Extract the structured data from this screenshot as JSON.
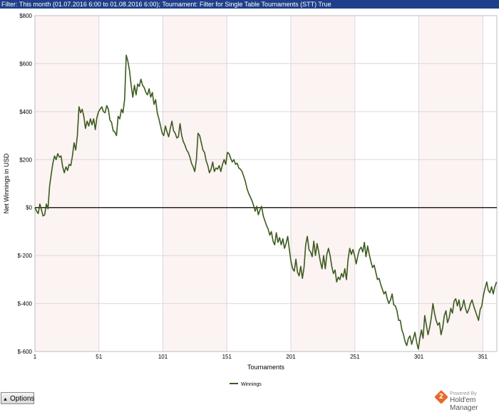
{
  "filter": {
    "text": "Filter: This month (01.07.2016 6:00 to 01.08.2016 6:00); Tournament: Filter for Single Table Tournaments (STT) True"
  },
  "chart_data": {
    "type": "line",
    "xlabel": "Tournaments",
    "ylabel": "Net Winnings in USD",
    "xlim": [
      1,
      362
    ],
    "ylim": [
      -600,
      800
    ],
    "x_ticks": [
      1,
      51,
      101,
      151,
      201,
      251,
      301,
      351
    ],
    "y_ticks": [
      -600,
      -400,
      -200,
      0,
      200,
      400,
      600,
      800
    ],
    "y_tick_labels": [
      "$-600",
      "$-400",
      "$-200",
      "$0",
      "$200",
      "$400",
      "$600",
      "$800"
    ],
    "grid": true,
    "legend_position": "bottom-center",
    "series": [
      {
        "name": "Winnings",
        "color": "#3c5a1e",
        "points": [
          [
            1,
            0
          ],
          [
            2,
            -15
          ],
          [
            3,
            -25
          ],
          [
            4,
            15
          ],
          [
            5,
            -10
          ],
          [
            6,
            -35
          ],
          [
            7,
            -30
          ],
          [
            8,
            15
          ],
          [
            9,
            -5
          ],
          [
            10,
            90
          ],
          [
            11,
            140
          ],
          [
            12,
            185
          ],
          [
            13,
            215
          ],
          [
            14,
            200
          ],
          [
            15,
            225
          ],
          [
            16,
            210
          ],
          [
            17,
            215
          ],
          [
            18,
            170
          ],
          [
            19,
            145
          ],
          [
            20,
            170
          ],
          [
            21,
            155
          ],
          [
            22,
            180
          ],
          [
            23,
            175
          ],
          [
            24,
            215
          ],
          [
            25,
            270
          ],
          [
            26,
            240
          ],
          [
            27,
            300
          ],
          [
            28,
            420
          ],
          [
            29,
            395
          ],
          [
            30,
            410
          ],
          [
            31,
            380
          ],
          [
            32,
            330
          ],
          [
            33,
            360
          ],
          [
            34,
            340
          ],
          [
            35,
            370
          ],
          [
            36,
            345
          ],
          [
            37,
            370
          ],
          [
            38,
            325
          ],
          [
            39,
            375
          ],
          [
            40,
            400
          ],
          [
            41,
            410
          ],
          [
            42,
            420
          ],
          [
            43,
            400
          ],
          [
            44,
            395
          ],
          [
            45,
            425
          ],
          [
            46,
            410
          ],
          [
            47,
            365
          ],
          [
            48,
            355
          ],
          [
            49,
            320
          ],
          [
            50,
            315
          ],
          [
            51,
            300
          ],
          [
            52,
            380
          ],
          [
            53,
            370
          ],
          [
            54,
            410
          ],
          [
            55,
            395
          ],
          [
            56,
            450
          ],
          [
            57,
            635
          ],
          [
            58,
            610
          ],
          [
            59,
            570
          ],
          [
            60,
            510
          ],
          [
            61,
            460
          ],
          [
            62,
            510
          ],
          [
            63,
            470
          ],
          [
            64,
            515
          ],
          [
            65,
            505
          ],
          [
            66,
            535
          ],
          [
            67,
            510
          ],
          [
            68,
            500
          ],
          [
            69,
            480
          ],
          [
            70,
            470
          ],
          [
            71,
            495
          ],
          [
            72,
            460
          ],
          [
            73,
            480
          ],
          [
            74,
            430
          ],
          [
            75,
            450
          ],
          [
            76,
            395
          ],
          [
            77,
            370
          ],
          [
            78,
            340
          ],
          [
            79,
            310
          ],
          [
            80,
            300
          ],
          [
            81,
            340
          ],
          [
            82,
            315
          ],
          [
            83,
            295
          ],
          [
            84,
            330
          ],
          [
            85,
            360
          ],
          [
            86,
            320
          ],
          [
            87,
            310
          ],
          [
            88,
            290
          ],
          [
            89,
            295
          ],
          [
            90,
            350
          ],
          [
            91,
            300
          ],
          [
            92,
            275
          ],
          [
            93,
            260
          ],
          [
            94,
            240
          ],
          [
            95,
            230
          ],
          [
            96,
            210
          ],
          [
            97,
            185
          ],
          [
            98,
            170
          ],
          [
            99,
            150
          ],
          [
            100,
            200
          ],
          [
            101,
            310
          ],
          [
            102,
            300
          ],
          [
            103,
            270
          ],
          [
            104,
            240
          ],
          [
            105,
            230
          ],
          [
            106,
            195
          ],
          [
            107,
            175
          ],
          [
            108,
            145
          ],
          [
            109,
            160
          ],
          [
            110,
            190
          ],
          [
            111,
            150
          ],
          [
            112,
            165
          ],
          [
            113,
            160
          ],
          [
            114,
            175
          ],
          [
            115,
            150
          ],
          [
            116,
            180
          ],
          [
            117,
            200
          ],
          [
            118,
            180
          ],
          [
            119,
            230
          ],
          [
            120,
            225
          ],
          [
            121,
            205
          ],
          [
            122,
            190
          ],
          [
            123,
            200
          ],
          [
            124,
            180
          ],
          [
            125,
            185
          ],
          [
            126,
            165
          ],
          [
            127,
            160
          ],
          [
            128,
            150
          ],
          [
            129,
            130
          ],
          [
            130,
            110
          ],
          [
            131,
            80
          ],
          [
            132,
            60
          ],
          [
            133,
            45
          ],
          [
            134,
            30
          ],
          [
            135,
            10
          ],
          [
            136,
            -15
          ],
          [
            137,
            5
          ],
          [
            138,
            -30
          ],
          [
            139,
            -10
          ],
          [
            140,
            5
          ],
          [
            141,
            -35
          ],
          [
            142,
            -55
          ],
          [
            143,
            -75
          ],
          [
            144,
            -90
          ],
          [
            145,
            -115
          ],
          [
            146,
            -100
          ],
          [
            147,
            -140
          ],
          [
            148,
            -155
          ],
          [
            149,
            -105
          ],
          [
            150,
            -145
          ],
          [
            151,
            -125
          ],
          [
            152,
            -155
          ],
          [
            153,
            -130
          ],
          [
            154,
            -170
          ],
          [
            155,
            -150
          ],
          [
            156,
            -120
          ],
          [
            157,
            -175
          ],
          [
            158,
            -225
          ],
          [
            159,
            -255
          ],
          [
            160,
            -265
          ],
          [
            161,
            -215
          ],
          [
            162,
            -270
          ],
          [
            163,
            -285
          ],
          [
            164,
            -245
          ],
          [
            165,
            -295
          ],
          [
            166,
            -250
          ],
          [
            167,
            -155
          ],
          [
            168,
            -120
          ],
          [
            169,
            -175
          ],
          [
            170,
            -185
          ],
          [
            171,
            -205
          ],
          [
            172,
            -140
          ],
          [
            173,
            -200
          ],
          [
            174,
            -150
          ],
          [
            175,
            -185
          ],
          [
            176,
            -225
          ],
          [
            177,
            -255
          ],
          [
            178,
            -200
          ],
          [
            179,
            -255
          ],
          [
            180,
            -195
          ],
          [
            181,
            -170
          ],
          [
            182,
            -200
          ],
          [
            183,
            -245
          ],
          [
            184,
            -275
          ],
          [
            185,
            -260
          ],
          [
            186,
            -310
          ],
          [
            187,
            -290
          ],
          [
            188,
            -300
          ],
          [
            189,
            -275
          ],
          [
            190,
            -290
          ],
          [
            191,
            -255
          ],
          [
            192,
            -300
          ],
          [
            193,
            -215
          ],
          [
            194,
            -170
          ],
          [
            195,
            -195
          ],
          [
            196,
            -175
          ],
          [
            197,
            -200
          ],
          [
            198,
            -235
          ],
          [
            199,
            -200
          ],
          [
            200,
            -175
          ],
          [
            201,
            -165
          ],
          [
            202,
            -185
          ],
          [
            203,
            -145
          ],
          [
            204,
            -205
          ],
          [
            205,
            -160
          ],
          [
            206,
            -195
          ],
          [
            207,
            -225
          ],
          [
            208,
            -250
          ],
          [
            209,
            -240
          ],
          [
            210,
            -270
          ],
          [
            211,
            -300
          ],
          [
            212,
            -295
          ],
          [
            213,
            -320
          ],
          [
            214,
            -340
          ],
          [
            215,
            -360
          ],
          [
            216,
            -350
          ],
          [
            217,
            -380
          ],
          [
            218,
            -400
          ],
          [
            219,
            -385
          ],
          [
            220,
            -360
          ],
          [
            221,
            -405
          ],
          [
            222,
            -410
          ],
          [
            223,
            -430
          ],
          [
            224,
            -470
          ],
          [
            225,
            -470
          ],
          [
            226,
            -510
          ],
          [
            227,
            -530
          ],
          [
            228,
            -560
          ],
          [
            229,
            -575
          ],
          [
            230,
            -545
          ],
          [
            231,
            -535
          ],
          [
            232,
            -570
          ],
          [
            233,
            -545
          ],
          [
            234,
            -520
          ],
          [
            235,
            -560
          ],
          [
            236,
            -590
          ],
          [
            237,
            -545
          ],
          [
            238,
            -510
          ],
          [
            239,
            -545
          ],
          [
            240,
            -450
          ],
          [
            241,
            -490
          ],
          [
            242,
            -530
          ],
          [
            243,
            -500
          ],
          [
            244,
            -460
          ],
          [
            245,
            -400
          ],
          [
            246,
            -440
          ],
          [
            247,
            -470
          ],
          [
            248,
            -490
          ],
          [
            249,
            -480
          ],
          [
            250,
            -530
          ],
          [
            251,
            -500
          ],
          [
            252,
            -450
          ],
          [
            253,
            -430
          ],
          [
            254,
            -480
          ],
          [
            255,
            -460
          ],
          [
            256,
            -420
          ],
          [
            257,
            -440
          ],
          [
            258,
            -390
          ],
          [
            259,
            -380
          ],
          [
            260,
            -410
          ],
          [
            261,
            -385
          ],
          [
            262,
            -430
          ],
          [
            263,
            -415
          ],
          [
            264,
            -385
          ],
          [
            265,
            -420
          ],
          [
            266,
            -440
          ],
          [
            267,
            -425
          ],
          [
            268,
            -400
          ],
          [
            269,
            -385
          ],
          [
            270,
            -410
          ],
          [
            271,
            -430
          ],
          [
            272,
            -450
          ],
          [
            273,
            -470
          ],
          [
            274,
            -425
          ],
          [
            275,
            -410
          ],
          [
            276,
            -365
          ],
          [
            277,
            -335
          ],
          [
            278,
            -310
          ],
          [
            279,
            -345
          ],
          [
            280,
            -355
          ],
          [
            281,
            -330
          ],
          [
            282,
            -360
          ],
          [
            283,
            -330
          ],
          [
            284,
            -310
          ]
        ],
        "x_scale": 1.2746
      }
    ]
  }
}
